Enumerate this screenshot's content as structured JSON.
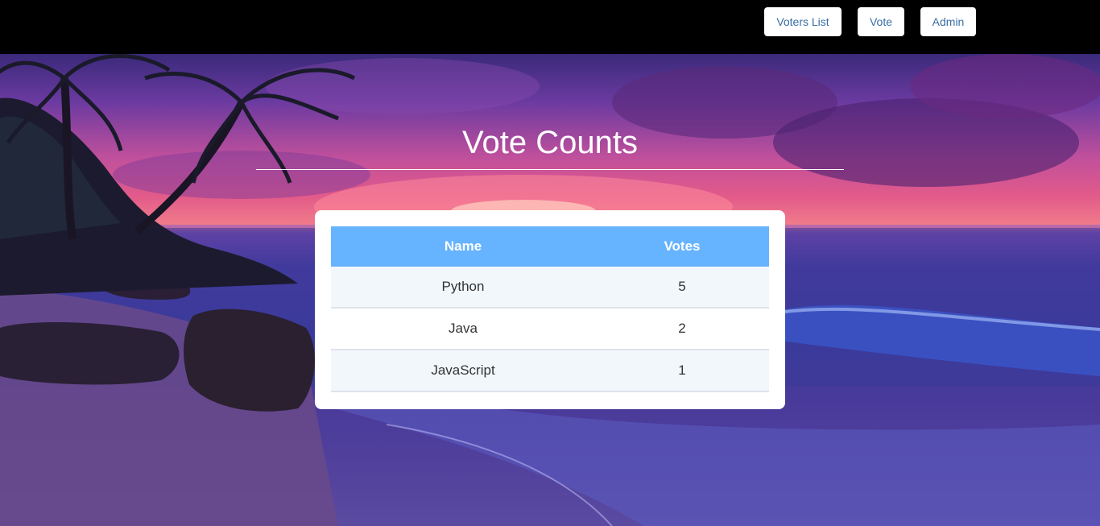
{
  "nav": {
    "voters_list_label": "Voters List",
    "vote_label": "Vote",
    "admin_label": "Admin"
  },
  "page": {
    "title": "Vote Counts"
  },
  "table": {
    "headers": {
      "name": "Name",
      "votes": "Votes"
    },
    "rows": [
      {
        "name": "Python",
        "votes": "5"
      },
      {
        "name": "Java",
        "votes": "2"
      },
      {
        "name": "JavaScript",
        "votes": "1"
      }
    ]
  },
  "colors": {
    "header_bg": "#66b3ff",
    "nav_text": "#3a6ea5",
    "topbar": "#000000"
  },
  "background": {
    "description_icon": "beach-sunset-image"
  }
}
